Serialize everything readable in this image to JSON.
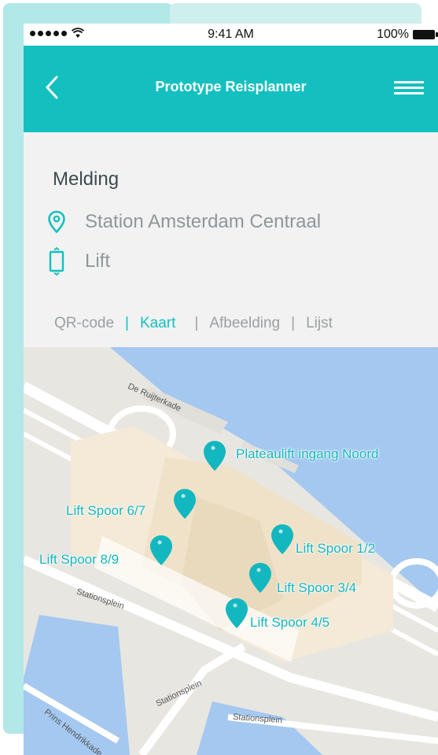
{
  "status_bar": {
    "time": "9:41 AM",
    "battery": "100%"
  },
  "nav": {
    "title": "Prototype Reisplanner"
  },
  "report": {
    "title": "Melding",
    "station": "Station Amsterdam Centraal",
    "type": "Lift"
  },
  "tabs": [
    {
      "label": "QR-code"
    },
    {
      "label": "Kaart"
    },
    {
      "label": "Afbeelding"
    },
    {
      "label": "Lijst"
    }
  ],
  "map": {
    "street_labels": [
      "De Ruijterkade",
      "Stationsplein",
      "Stationsplein",
      "Stationsplein",
      "Prins Hendrikkade"
    ],
    "pins": [
      {
        "label": "Plateaulift ingang Noord"
      },
      {
        "label": "Lift Spoor 6/7"
      },
      {
        "label": "Lift Spoor 1/2"
      },
      {
        "label": "Lift Spoor 8/9"
      },
      {
        "label": "Lift Spoor 3/4"
      },
      {
        "label": "Lift Spoor 4/5"
      }
    ]
  },
  "colors": {
    "accent": "#13c0bf",
    "water": "#a4c8f0",
    "land": "#e8e6e1",
    "building": "#f4ead7"
  }
}
